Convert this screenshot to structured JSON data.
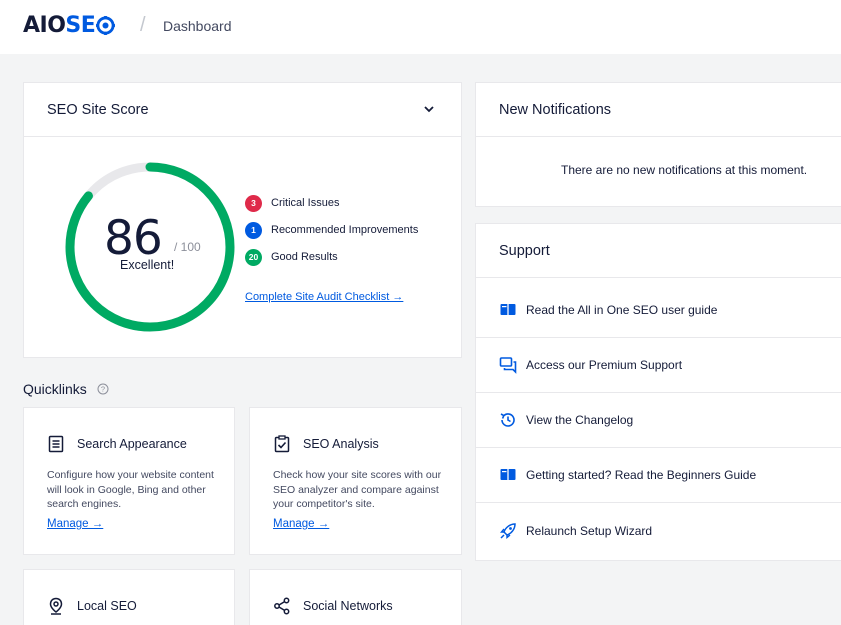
{
  "header": {
    "logo_part1": "AIO",
    "logo_part2": "SE",
    "separator": "/",
    "breadcrumb": "Dashboard"
  },
  "score_card": {
    "title": "SEO Site Score",
    "score": "86",
    "total": "/ 100",
    "rating": "Excellent!",
    "score_fraction": 0.86,
    "issues": [
      {
        "count": "3",
        "label": "Critical Issues",
        "color": "#df2a4a"
      },
      {
        "count": "1",
        "label": "Recommended Improvements",
        "color": "#005ae0"
      },
      {
        "count": "20",
        "label": "Good Results",
        "color": "#00aa63"
      }
    ],
    "audit_link": "Complete Site Audit Checklist →"
  },
  "quicklinks": {
    "title": "Quicklinks",
    "items": [
      {
        "title": "Search Appearance",
        "icon": "document-list-icon",
        "desc": "Configure how your website content will look in Google, Bing and other search engines.",
        "manage": "Manage →"
      },
      {
        "title": "SEO Analysis",
        "icon": "clipboard-check-icon",
        "desc": "Check how your site scores with our SEO analyzer and compare against your competitor's site.",
        "manage": "Manage →"
      },
      {
        "title": "Local SEO",
        "icon": "location-pin-icon",
        "desc": "",
        "manage": ""
      },
      {
        "title": "Social Networks",
        "icon": "share-icon",
        "desc": "",
        "manage": ""
      }
    ]
  },
  "notifications": {
    "title": "New Notifications",
    "message": "There are no new notifications at this moment."
  },
  "support": {
    "title": "Support",
    "items": [
      {
        "label": "Read the All in One SEO user guide",
        "icon": "book-icon"
      },
      {
        "label": "Access our Premium Support",
        "icon": "chat-icon"
      },
      {
        "label": "View the Changelog",
        "icon": "history-icon"
      },
      {
        "label": "Getting started? Read the Beginners Guide",
        "icon": "book-icon"
      },
      {
        "label": "Relaunch Setup Wizard",
        "icon": "rocket-icon"
      }
    ]
  },
  "colors": {
    "brand_blue": "#005ae0",
    "success_green": "#00aa63",
    "critical_red": "#df2a4a",
    "text_dark": "#141b38"
  }
}
